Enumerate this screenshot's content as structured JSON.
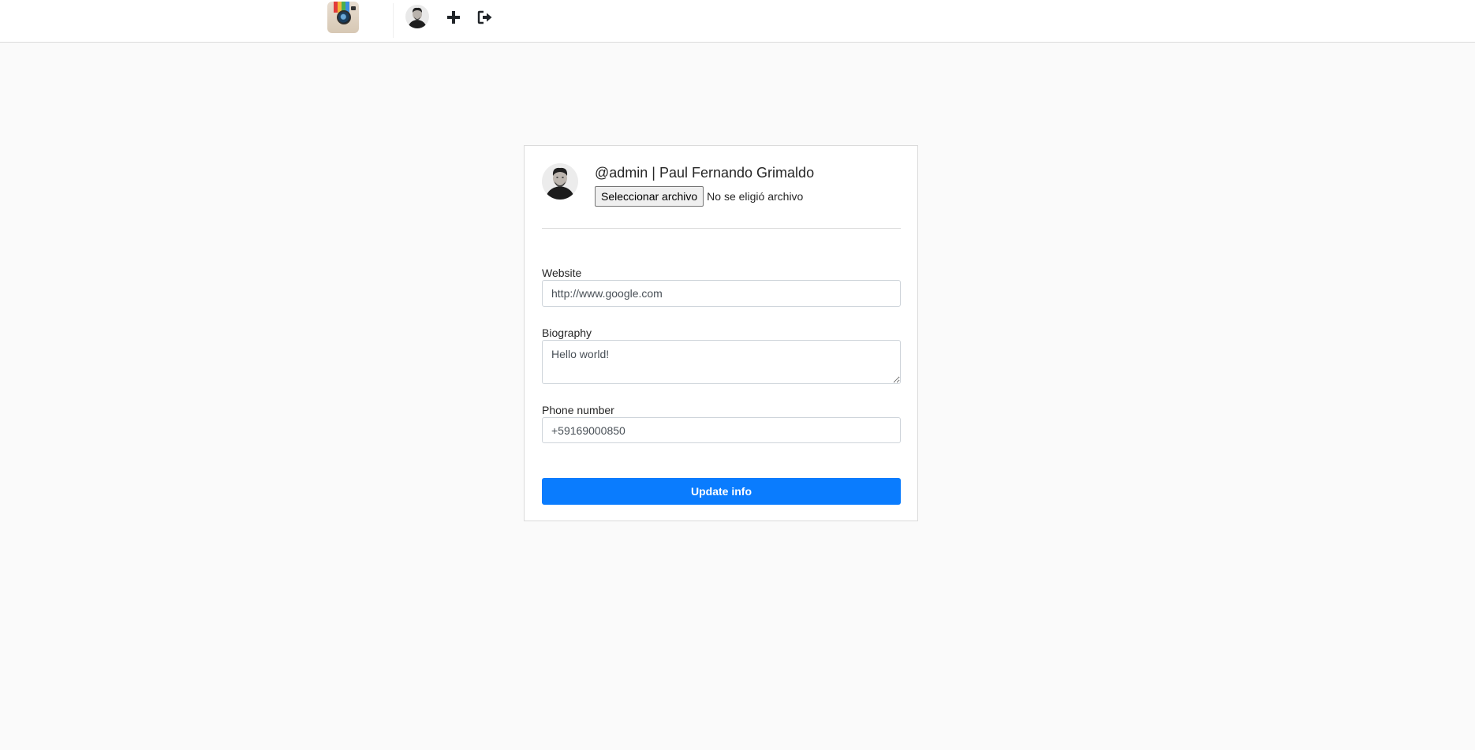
{
  "nav": {
    "logo_icon": "instagram-camera-logo",
    "icons": [
      "profile-avatar",
      "plus-icon",
      "sign-out-icon"
    ]
  },
  "profile": {
    "title": "@admin | Paul Fernando Grimaldo",
    "file_button_label": "Seleccionar archivo",
    "file_status": "No se eligió archivo"
  },
  "form": {
    "website": {
      "label": "Website",
      "value": "http://www.google.com"
    },
    "biography": {
      "label": "Biography",
      "value": "Hello world!"
    },
    "phone": {
      "label": "Phone number",
      "value": "+59169000850"
    },
    "submit_label": "Update info"
  },
  "colors": {
    "accent": "#0a7cfe",
    "background": "#fafafa",
    "border": "#dbdbdb"
  }
}
